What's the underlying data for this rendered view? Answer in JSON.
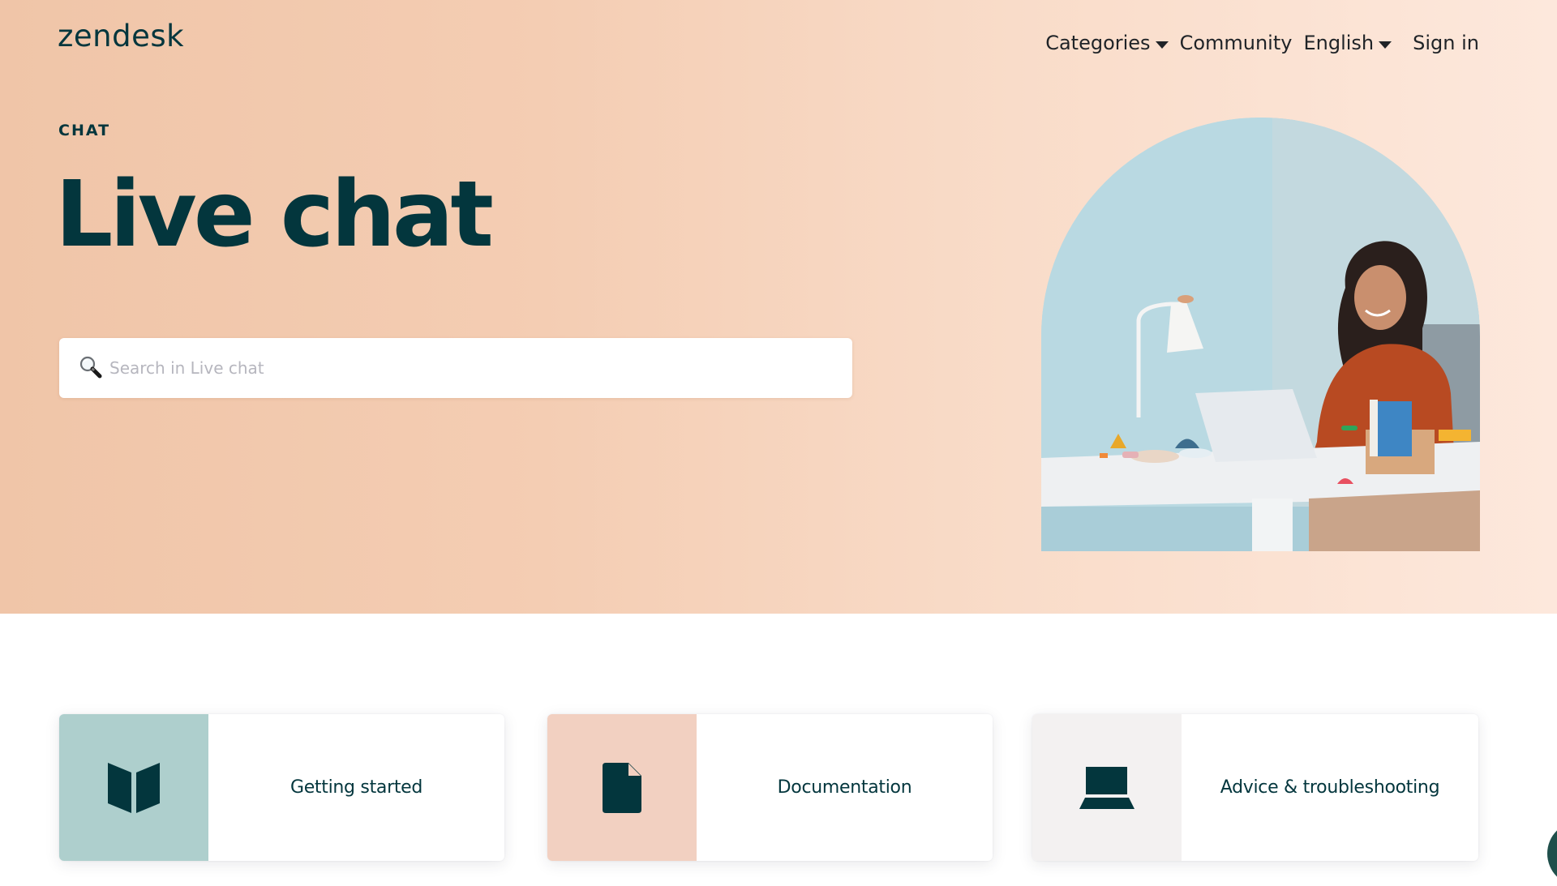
{
  "header": {
    "logo": "zendesk",
    "nav": [
      {
        "label": "Categories",
        "has_dropdown": true
      },
      {
        "label": "Community",
        "has_dropdown": false
      },
      {
        "label": "English",
        "has_dropdown": true
      },
      {
        "label": "Sign in",
        "has_dropdown": false
      }
    ]
  },
  "hero": {
    "eyebrow": "CHAT",
    "title": "Live chat",
    "search": {
      "placeholder": "Search in Live chat",
      "value": "",
      "icon": "magnifying-glass-icon"
    },
    "image_alt": "Woman smiling at laptop at a white desk with a lamp"
  },
  "cards": [
    {
      "label": "Getting started",
      "icon": "open-book-icon",
      "panel_color": "#AECFCD"
    },
    {
      "label": "Documentation",
      "icon": "document-icon",
      "panel_color": "#F2D0C1"
    },
    {
      "label": "Advice & troubleshooting",
      "icon": "laptop-icon",
      "panel_color": "#F3F1F1"
    }
  ],
  "colors": {
    "brand_dark": "#03363D",
    "hero_left": "#F0C5A8",
    "hero_right": "#FDE8DC",
    "chat_widget": "#1F4F4B"
  }
}
